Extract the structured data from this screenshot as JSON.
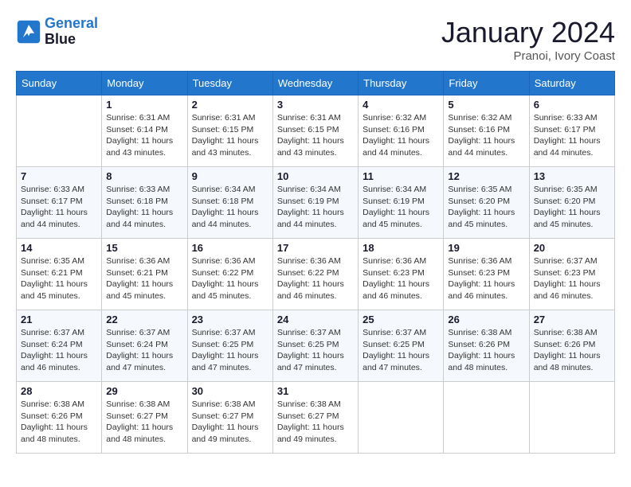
{
  "header": {
    "logo_line1": "General",
    "logo_line2": "Blue",
    "month": "January 2024",
    "location": "Pranoi, Ivory Coast"
  },
  "weekdays": [
    "Sunday",
    "Monday",
    "Tuesday",
    "Wednesday",
    "Thursday",
    "Friday",
    "Saturday"
  ],
  "weeks": [
    [
      {
        "day": "",
        "info": ""
      },
      {
        "day": "1",
        "info": "Sunrise: 6:31 AM\nSunset: 6:14 PM\nDaylight: 11 hours\nand 43 minutes."
      },
      {
        "day": "2",
        "info": "Sunrise: 6:31 AM\nSunset: 6:15 PM\nDaylight: 11 hours\nand 43 minutes."
      },
      {
        "day": "3",
        "info": "Sunrise: 6:31 AM\nSunset: 6:15 PM\nDaylight: 11 hours\nand 43 minutes."
      },
      {
        "day": "4",
        "info": "Sunrise: 6:32 AM\nSunset: 6:16 PM\nDaylight: 11 hours\nand 44 minutes."
      },
      {
        "day": "5",
        "info": "Sunrise: 6:32 AM\nSunset: 6:16 PM\nDaylight: 11 hours\nand 44 minutes."
      },
      {
        "day": "6",
        "info": "Sunrise: 6:33 AM\nSunset: 6:17 PM\nDaylight: 11 hours\nand 44 minutes."
      }
    ],
    [
      {
        "day": "7",
        "info": "Sunrise: 6:33 AM\nSunset: 6:17 PM\nDaylight: 11 hours\nand 44 minutes."
      },
      {
        "day": "8",
        "info": "Sunrise: 6:33 AM\nSunset: 6:18 PM\nDaylight: 11 hours\nand 44 minutes."
      },
      {
        "day": "9",
        "info": "Sunrise: 6:34 AM\nSunset: 6:18 PM\nDaylight: 11 hours\nand 44 minutes."
      },
      {
        "day": "10",
        "info": "Sunrise: 6:34 AM\nSunset: 6:19 PM\nDaylight: 11 hours\nand 44 minutes."
      },
      {
        "day": "11",
        "info": "Sunrise: 6:34 AM\nSunset: 6:19 PM\nDaylight: 11 hours\nand 45 minutes."
      },
      {
        "day": "12",
        "info": "Sunrise: 6:35 AM\nSunset: 6:20 PM\nDaylight: 11 hours\nand 45 minutes."
      },
      {
        "day": "13",
        "info": "Sunrise: 6:35 AM\nSunset: 6:20 PM\nDaylight: 11 hours\nand 45 minutes."
      }
    ],
    [
      {
        "day": "14",
        "info": "Sunrise: 6:35 AM\nSunset: 6:21 PM\nDaylight: 11 hours\nand 45 minutes."
      },
      {
        "day": "15",
        "info": "Sunrise: 6:36 AM\nSunset: 6:21 PM\nDaylight: 11 hours\nand 45 minutes."
      },
      {
        "day": "16",
        "info": "Sunrise: 6:36 AM\nSunset: 6:22 PM\nDaylight: 11 hours\nand 45 minutes."
      },
      {
        "day": "17",
        "info": "Sunrise: 6:36 AM\nSunset: 6:22 PM\nDaylight: 11 hours\nand 46 minutes."
      },
      {
        "day": "18",
        "info": "Sunrise: 6:36 AM\nSunset: 6:23 PM\nDaylight: 11 hours\nand 46 minutes."
      },
      {
        "day": "19",
        "info": "Sunrise: 6:36 AM\nSunset: 6:23 PM\nDaylight: 11 hours\nand 46 minutes."
      },
      {
        "day": "20",
        "info": "Sunrise: 6:37 AM\nSunset: 6:23 PM\nDaylight: 11 hours\nand 46 minutes."
      }
    ],
    [
      {
        "day": "21",
        "info": "Sunrise: 6:37 AM\nSunset: 6:24 PM\nDaylight: 11 hours\nand 46 minutes."
      },
      {
        "day": "22",
        "info": "Sunrise: 6:37 AM\nSunset: 6:24 PM\nDaylight: 11 hours\nand 47 minutes."
      },
      {
        "day": "23",
        "info": "Sunrise: 6:37 AM\nSunset: 6:25 PM\nDaylight: 11 hours\nand 47 minutes."
      },
      {
        "day": "24",
        "info": "Sunrise: 6:37 AM\nSunset: 6:25 PM\nDaylight: 11 hours\nand 47 minutes."
      },
      {
        "day": "25",
        "info": "Sunrise: 6:37 AM\nSunset: 6:25 PM\nDaylight: 11 hours\nand 47 minutes."
      },
      {
        "day": "26",
        "info": "Sunrise: 6:38 AM\nSunset: 6:26 PM\nDaylight: 11 hours\nand 48 minutes."
      },
      {
        "day": "27",
        "info": "Sunrise: 6:38 AM\nSunset: 6:26 PM\nDaylight: 11 hours\nand 48 minutes."
      }
    ],
    [
      {
        "day": "28",
        "info": "Sunrise: 6:38 AM\nSunset: 6:26 PM\nDaylight: 11 hours\nand 48 minutes."
      },
      {
        "day": "29",
        "info": "Sunrise: 6:38 AM\nSunset: 6:27 PM\nDaylight: 11 hours\nand 48 minutes."
      },
      {
        "day": "30",
        "info": "Sunrise: 6:38 AM\nSunset: 6:27 PM\nDaylight: 11 hours\nand 49 minutes."
      },
      {
        "day": "31",
        "info": "Sunrise: 6:38 AM\nSunset: 6:27 PM\nDaylight: 11 hours\nand 49 minutes."
      },
      {
        "day": "",
        "info": ""
      },
      {
        "day": "",
        "info": ""
      },
      {
        "day": "",
        "info": ""
      }
    ]
  ]
}
